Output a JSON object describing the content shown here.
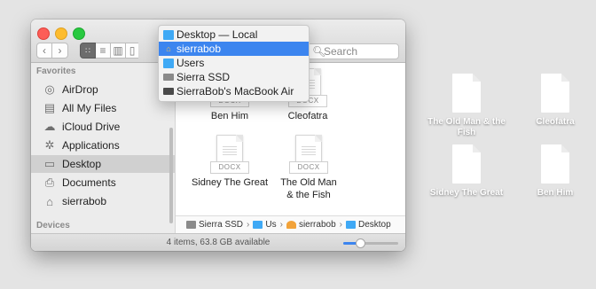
{
  "finder": {
    "search_placeholder": "Search",
    "sidebar": {
      "favorites_header": "Favorites",
      "items": [
        {
          "label": "AirDrop",
          "icon": "airdrop-icon"
        },
        {
          "label": "All My Files",
          "icon": "all-files-icon"
        },
        {
          "label": "iCloud Drive",
          "icon": "cloud-icon"
        },
        {
          "label": "Applications",
          "icon": "applications-icon"
        },
        {
          "label": "Desktop",
          "icon": "desktop-icon",
          "selected": true
        },
        {
          "label": "Documents",
          "icon": "documents-icon"
        },
        {
          "label": "sierrabob",
          "icon": "home-icon"
        }
      ],
      "devices_header": "Devices"
    },
    "files": [
      {
        "name": "Ben Him",
        "ext": "DOCX"
      },
      {
        "name": "Cleofatra",
        "ext": "DOCX"
      },
      {
        "name": "Sidney The Great",
        "ext": "DOCX"
      },
      {
        "name": "The Old Man & the Fish",
        "ext": "DOCX"
      }
    ],
    "path": [
      {
        "label": "Sierra SSD",
        "icon": "drive-icon"
      },
      {
        "label": "Us",
        "icon": "folder-icon"
      },
      {
        "label": "sierrabob",
        "icon": "home-icon"
      },
      {
        "label": "Desktop",
        "icon": "folder-icon"
      }
    ],
    "status_text": "4 items, 63.8 GB available",
    "icon_size_zoom_fraction": 0.3
  },
  "path_dropdown": {
    "items": [
      {
        "label": "Desktop — Local",
        "icon": "folder-icon"
      },
      {
        "label": "sierrabob",
        "icon": "home-icon",
        "selected": true
      },
      {
        "label": "Users",
        "icon": "folder-icon"
      },
      {
        "label": "Sierra SSD",
        "icon": "drive-icon"
      },
      {
        "label": "SierraBob's MacBook Air",
        "icon": "laptop-icon"
      }
    ]
  },
  "desktop_icons": [
    {
      "label": "The Old Man & the Fish"
    },
    {
      "label": "Cleofatra"
    },
    {
      "label": "Sidney The Great"
    },
    {
      "label": "Ben Him"
    }
  ],
  "colors": {
    "accent": "#3c85ef",
    "folder": "#3fa9f5",
    "desktop_bg": "#e4e4e4"
  }
}
